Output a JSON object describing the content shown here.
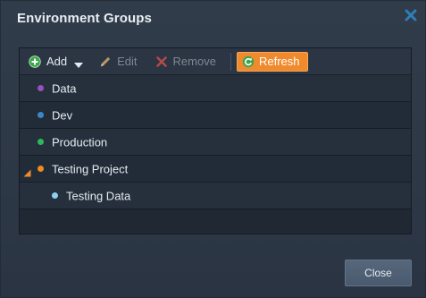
{
  "dialog": {
    "title": "Environment Groups",
    "close_icon": "close-icon"
  },
  "toolbar": {
    "add_label": "Add",
    "edit_label": "Edit",
    "remove_label": "Remove",
    "refresh_label": "Refresh"
  },
  "groups": [
    {
      "label": "Data",
      "color": "#9b4fc0",
      "level": 0
    },
    {
      "label": "Dev",
      "color": "#3b86c6",
      "level": 0
    },
    {
      "label": "Production",
      "color": "#2eb85c",
      "level": 0
    },
    {
      "label": "Testing Project",
      "color": "#ef8a1f",
      "level": 0,
      "expanded": true
    },
    {
      "label": "Testing Data",
      "color": "#8fd0f0",
      "level": 1
    }
  ],
  "footer": {
    "close_label": "Close"
  },
  "colors": {
    "accent": "#f08a2c",
    "background": "#2f3a48"
  }
}
